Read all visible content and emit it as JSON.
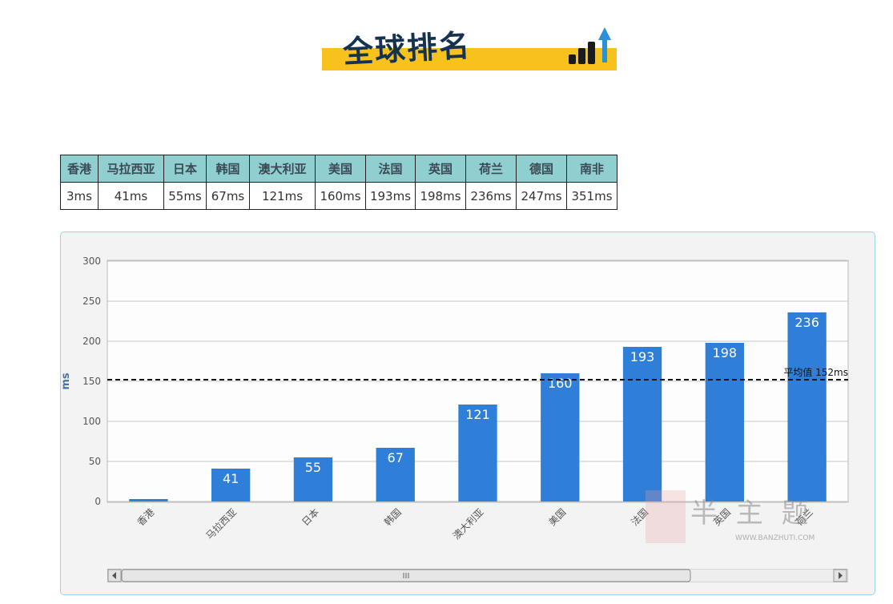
{
  "header": {
    "title": "全球排名"
  },
  "ranking_table": {
    "countries": [
      "香港",
      "马拉西亚",
      "日本",
      "韩国",
      "澳大利亚",
      "美国",
      "法国",
      "英国",
      "荷兰",
      "德国",
      "南非"
    ],
    "latency": [
      "3ms",
      "41ms",
      "55ms",
      "67ms",
      "121ms",
      "160ms",
      "193ms",
      "198ms",
      "236ms",
      "247ms",
      "351ms"
    ]
  },
  "chart_data": {
    "type": "bar",
    "categories": [
      "香港",
      "马拉西亚",
      "日本",
      "韩国",
      "澳大利亚",
      "美国",
      "法国",
      "英国",
      "荷兰"
    ],
    "values": [
      3,
      41,
      55,
      67,
      121,
      160,
      193,
      198,
      236
    ],
    "ylabel": "ms",
    "ylim": [
      0,
      300
    ],
    "yticks": [
      0,
      50,
      100,
      150,
      200,
      250,
      300
    ],
    "average": {
      "value": 152,
      "label": "平均值 152ms"
    },
    "bar_color": "#2f7ed8",
    "grid": true,
    "scrollbar": true
  },
  "watermark": {
    "text": "半 主 题",
    "url": "WWW.BANZHUTI.COM"
  },
  "colors": {
    "table_header": "#8fcfcf",
    "banner": "#f7c21e",
    "panel_border": "#9fd3ea"
  }
}
